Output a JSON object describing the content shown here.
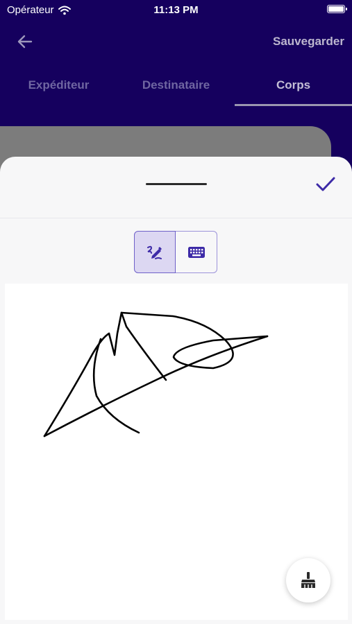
{
  "status_bar": {
    "carrier": "Opérateur",
    "time": "11:13 PM"
  },
  "app_bar": {
    "back_icon": "arrow-left-icon",
    "save_label": "Sauvegarder"
  },
  "tabs": [
    {
      "label": "Expéditeur",
      "active": false
    },
    {
      "label": "Destinataire",
      "active": false
    },
    {
      "label": "Corps",
      "active": true
    }
  ],
  "signature_sheet": {
    "confirm_icon": "check-icon",
    "modes": [
      {
        "name": "draw",
        "icon": "pen-draw-icon",
        "selected": true
      },
      {
        "name": "keyboard",
        "icon": "keyboard-icon",
        "selected": false
      }
    ],
    "clear_icon": "broom-icon"
  },
  "colors": {
    "app_bar_background": "#15005e",
    "accent": "#3d2aa7",
    "sheet_background": "#f7f7f8",
    "overlay_card": "#7c7c7c"
  }
}
